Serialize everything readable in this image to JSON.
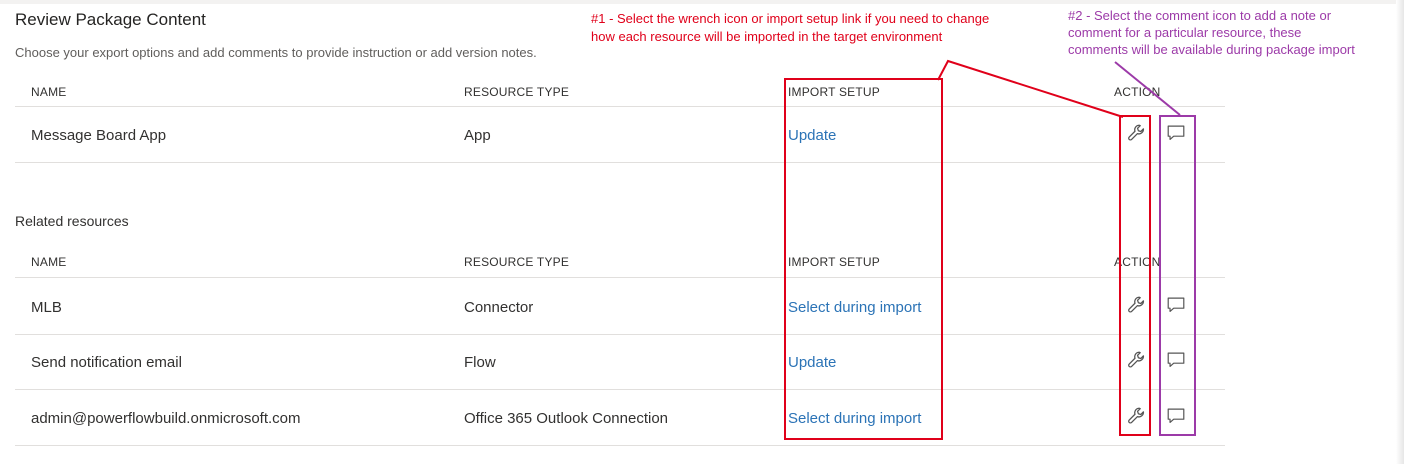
{
  "page": {
    "title": "Review Package Content",
    "subtitle": "Choose your export options and add comments to provide instruction or add version notes."
  },
  "columns": {
    "name": "NAME",
    "resource_type": "RESOURCE TYPE",
    "import_setup": "IMPORT SETUP",
    "action": "ACTION"
  },
  "main_rows": [
    {
      "name": "Message Board App",
      "type": "App",
      "import_setup": "Update"
    }
  ],
  "related": {
    "label": "Related resources",
    "rows": [
      {
        "name": "MLB",
        "type": "Connector",
        "import_setup": "Select during import"
      },
      {
        "name": "Send notification email",
        "type": "Flow",
        "import_setup": "Update"
      },
      {
        "name": "admin@powerflowbuild.onmicrosoft.com",
        "type": "Office 365 Outlook Connection",
        "import_setup": "Select during import"
      }
    ]
  },
  "annotations": {
    "note1_line1": "#1 - Select the wrench icon or import setup link if you need to change",
    "note1_line2": "how each resource will be imported in the target environment",
    "note2_line1": "#2 - Select the comment icon to add a note or",
    "note2_line2": "comment for a particular resource, these",
    "note2_line3": "comments will be available during package import",
    "red_color": "#e0001a",
    "purple_color": "#9c3aa8"
  },
  "icons": {
    "wrench": "wrench-icon",
    "comment": "comment-icon"
  },
  "colors": {
    "link": "#2b73b6",
    "text": "#323130",
    "divider": "#e1dfdd"
  }
}
